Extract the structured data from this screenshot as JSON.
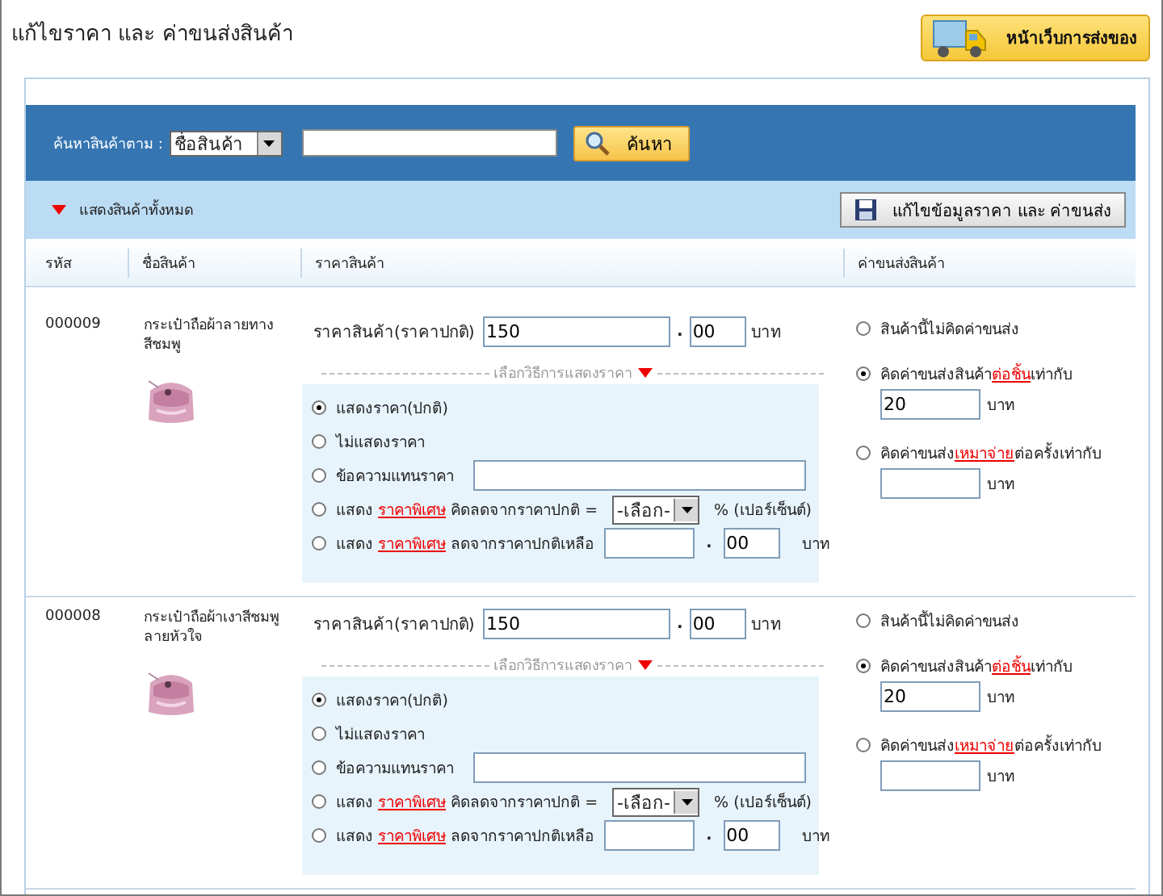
{
  "page_title": "แก้ไขราคา และ ค่าขนส่งสินค้า",
  "shipping_page_button": "หน้าเว็บการส่งของ",
  "search": {
    "label": "ค้นหาสินค้าตาม :",
    "field_select": "ชื่อสินค้า",
    "button": "ค้นหา"
  },
  "show_all": "แสดงสินค้าทั้งหมด",
  "save_button": "แก้ไขข้อมูลราคา และ ค่าขนส่ง",
  "columns": [
    "รหัส",
    "ชื่อสินค้า",
    "ราคาสินค้า",
    "ค่าขนส่งสินค้า"
  ],
  "products": [
    {
      "id": "000009",
      "name": "กระเป๋าถือผ้าลายทางสีชมพู",
      "image": {
        "kind": "picture"
      },
      "price_label": "ราคาสินค้า(ราคาปกติ)",
      "price": "150",
      "separator": ".",
      "price_decimal": "00",
      "unit": "บาท",
      "display_title": "เลือกวิธีการแสดงราคา",
      "display_options": [
        {
          "kind": "plain",
          "selected": true,
          "label": "แสดงราคา(ปกติ)"
        },
        {
          "kind": "plain",
          "selected": false,
          "label": "ไม่แสดงราคา"
        },
        {
          "kind": "text",
          "selected": false,
          "label": "ข้อความแทนราคา"
        },
        {
          "kind": "percent",
          "selected": false,
          "before": "แสดง",
          "link": "ราคาพิเศษ",
          "after": "คิดลดจากราคาปกติ =",
          "select": "-เลือก-",
          "suffix": "% (เปอร์เซ็นต์)"
        },
        {
          "kind": "amount",
          "selected": false,
          "before": "แสดง",
          "link": "ราคาพิเศษ",
          "after": "ลดจากราคาปกติเหลือ",
          "separator": ".",
          "decimal": "00",
          "unit": "บาท"
        }
      ],
      "shipping_options": [
        {
          "kind": "plain",
          "selected": false,
          "label": "สินค้านี้ไม่คิดค่าขนส่ง"
        },
        {
          "kind": "amount",
          "selected": true,
          "before": "คิดค่าขนส่งสินค้า",
          "link": "ต่อชิ้น",
          "after": "เท่ากับ",
          "value": "20",
          "unit": "บาท"
        },
        {
          "kind": "amount",
          "selected": false,
          "before": "คิดค่าขนส่ง",
          "link": "เหมาจ่าย",
          "after": "ต่อครั้งเท่ากับ",
          "unit": "บาท"
        }
      ]
    },
    {
      "id": "000008",
      "name": "กระเป๋าถือผ้าเงาสีชมพูลายหัวใจ",
      "image": {
        "kind": "picture"
      },
      "price_label": "ราคาสินค้า(ราคาปกติ)",
      "price": "150",
      "separator": ".",
      "price_decimal": "00",
      "unit": "บาท",
      "display_title": "เลือกวิธีการแสดงราคา",
      "display_options": [
        {
          "kind": "plain",
          "selected": true,
          "label": "แสดงราคา(ปกติ)"
        },
        {
          "kind": "plain",
          "selected": false,
          "label": "ไม่แสดงราคา"
        },
        {
          "kind": "text",
          "selected": false,
          "label": "ข้อความแทนราคา"
        },
        {
          "kind": "percent",
          "selected": false,
          "before": "แสดง",
          "link": "ราคาพิเศษ",
          "after": "คิดลดจากราคาปกติ =",
          "select": "-เลือก-",
          "suffix": "% (เปอร์เซ็นต์)"
        },
        {
          "kind": "amount",
          "selected": false,
          "before": "แสดง",
          "link": "ราคาพิเศษ",
          "after": "ลดจากราคาปกติเหลือ",
          "separator": ".",
          "decimal": "00",
          "unit": "บาท"
        }
      ],
      "shipping_options": [
        {
          "kind": "plain",
          "selected": false,
          "label": "สินค้านี้ไม่คิดค่าขนส่ง"
        },
        {
          "kind": "amount",
          "selected": true,
          "before": "คิดค่าขนส่งสินค้า",
          "link": "ต่อชิ้น",
          "after": "เท่ากับ",
          "value": "20",
          "unit": "บาท"
        },
        {
          "kind": "amount",
          "selected": false,
          "before": "คิดค่าขนส่ง",
          "link": "เหมาจ่าย",
          "after": "ต่อครั้งเท่ากับ",
          "unit": "บาท"
        }
      ]
    }
  ]
}
